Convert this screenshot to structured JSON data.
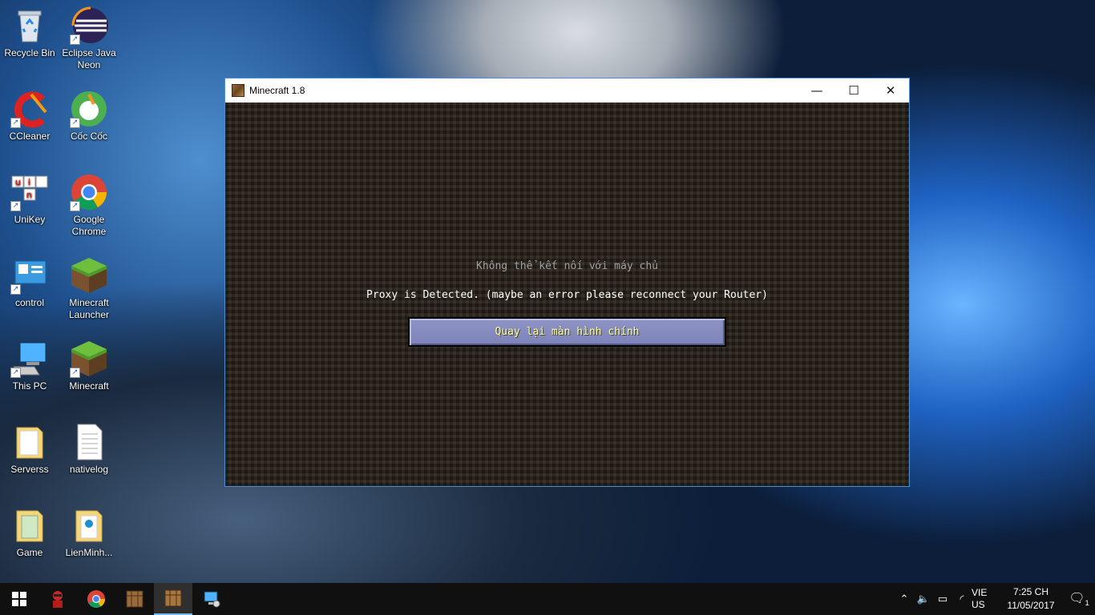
{
  "desktop": {
    "icons": [
      {
        "label": "Recycle Bin",
        "icon": "recycle-bin-icon"
      },
      {
        "label": "Eclipse Java Neon",
        "icon": "eclipse-icon"
      },
      {
        "label": "CCleaner",
        "icon": "ccleaner-icon"
      },
      {
        "label": "Cốc Cốc",
        "icon": "coccoc-icon"
      },
      {
        "label": "UniKey",
        "icon": "unikey-icon"
      },
      {
        "label": "Google Chrome",
        "icon": "chrome-icon"
      },
      {
        "label": "control",
        "icon": "control-panel-icon"
      },
      {
        "label": "Minecraft Launcher",
        "icon": "minecraft-grass-icon"
      },
      {
        "label": "This PC",
        "icon": "computer-icon"
      },
      {
        "label": "Minecraft",
        "icon": "minecraft-grass-icon"
      },
      {
        "label": "Serverss",
        "icon": "folder-icon"
      },
      {
        "label": "nativelog",
        "icon": "text-file-icon"
      },
      {
        "label": "Game",
        "icon": "folder-icon"
      },
      {
        "label": "LienMinh...",
        "icon": "folder-icon"
      }
    ]
  },
  "window": {
    "title": "Minecraft 1.8",
    "minimize_glyph": "—",
    "maximize_glyph": "☐",
    "close_glyph": "✕",
    "message_title": "Không thể kết nối với máy chủ",
    "message_reason": "Proxy is Detected. (maybe an error please reconnect your Router)",
    "back_button": "Quay lại màn hình chính"
  },
  "taskbar": {
    "lang_top": "VIE",
    "lang_bottom": "US",
    "time": "7:25 CH",
    "date": "11/05/2017",
    "notification_count": "1"
  }
}
